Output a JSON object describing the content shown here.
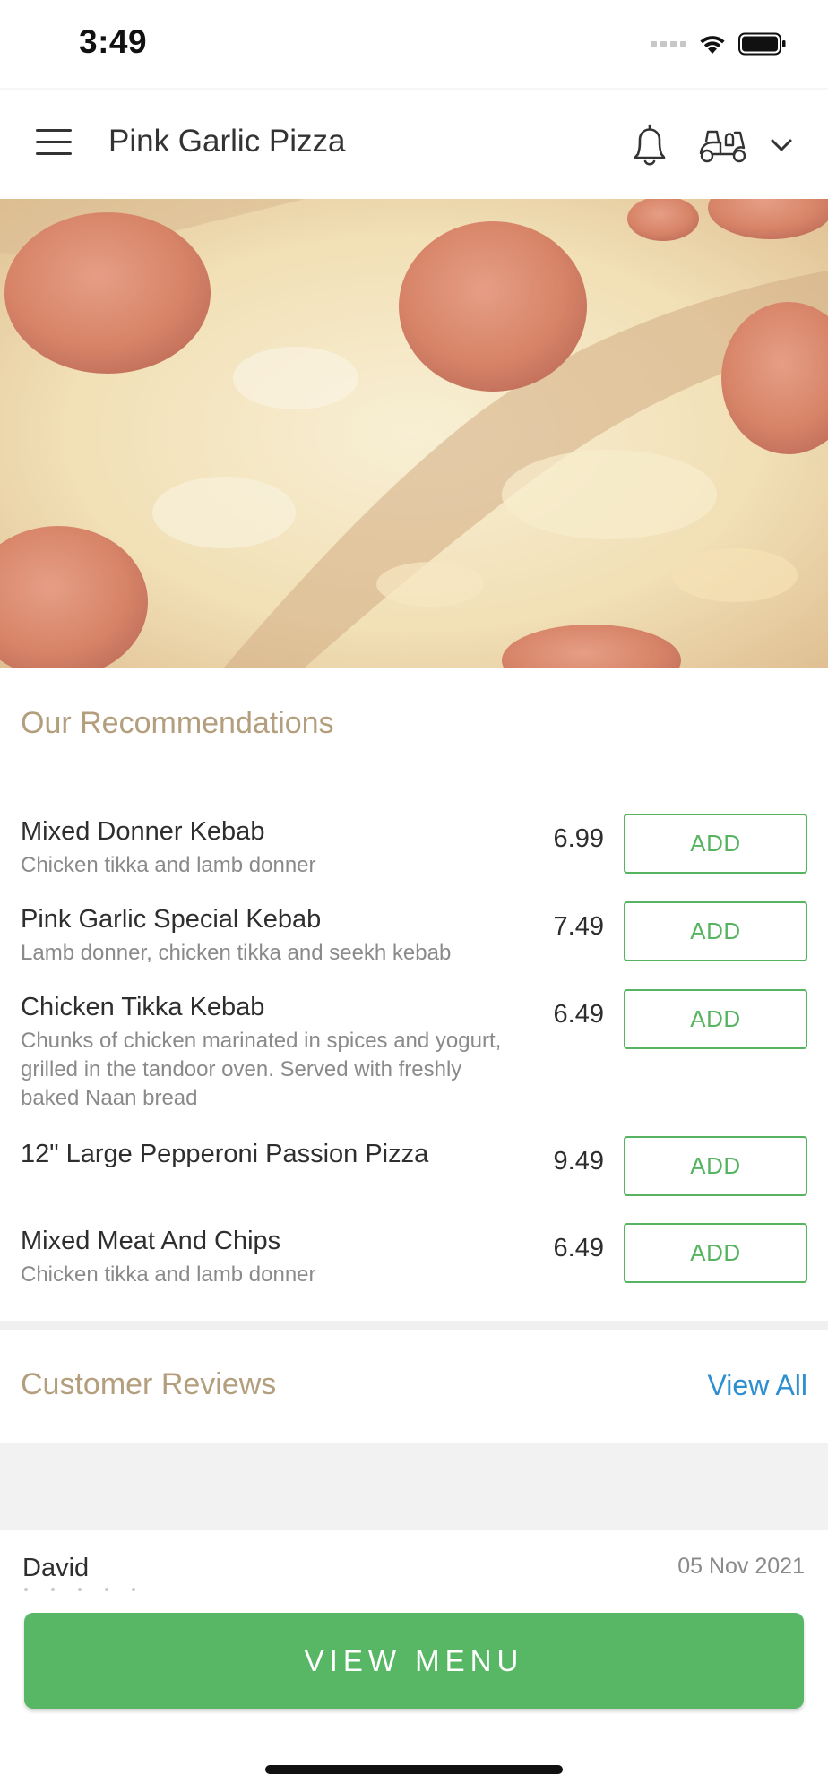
{
  "status_bar": {
    "time": "3:49"
  },
  "header": {
    "title": "Pink Garlic Pizza",
    "icons": [
      "hamburger-menu-icon",
      "bell-icon",
      "scooter-delivery-icon",
      "chevron-down-icon"
    ]
  },
  "hero": {
    "image": "pepperoni-pizza-photo"
  },
  "recommendations": {
    "title": "Our Recommendations",
    "add_label": "ADD",
    "items": [
      {
        "name": "Mixed Donner Kebab",
        "desc": "Chicken tikka and lamb donner",
        "price": "6.99"
      },
      {
        "name": "Pink Garlic Special Kebab",
        "desc": "Lamb donner, chicken tikka and seekh kebab",
        "price": "7.49"
      },
      {
        "name": "Chicken Tikka Kebab",
        "desc": "Chunks of chicken marinated in spices and yogurt, grilled in the tandoor oven. Served with freshly baked Naan bread",
        "price": "6.49"
      },
      {
        "name": "12\" Large Pepperoni Passion Pizza",
        "desc": "",
        "price": "9.49"
      },
      {
        "name": "Mixed Meat And Chips",
        "desc": "Chicken tikka and lamb donner",
        "price": "6.49"
      }
    ]
  },
  "reviews": {
    "title": "Customer Reviews",
    "view_all": "View All",
    "items": [
      {
        "name": "David",
        "date": "05 Nov 2021"
      }
    ]
  },
  "footer": {
    "view_menu": "VIEW MENU"
  },
  "colors": {
    "accent_green": "#58b765",
    "section_title": "#b39f7d",
    "link_blue": "#2e8fd0"
  }
}
